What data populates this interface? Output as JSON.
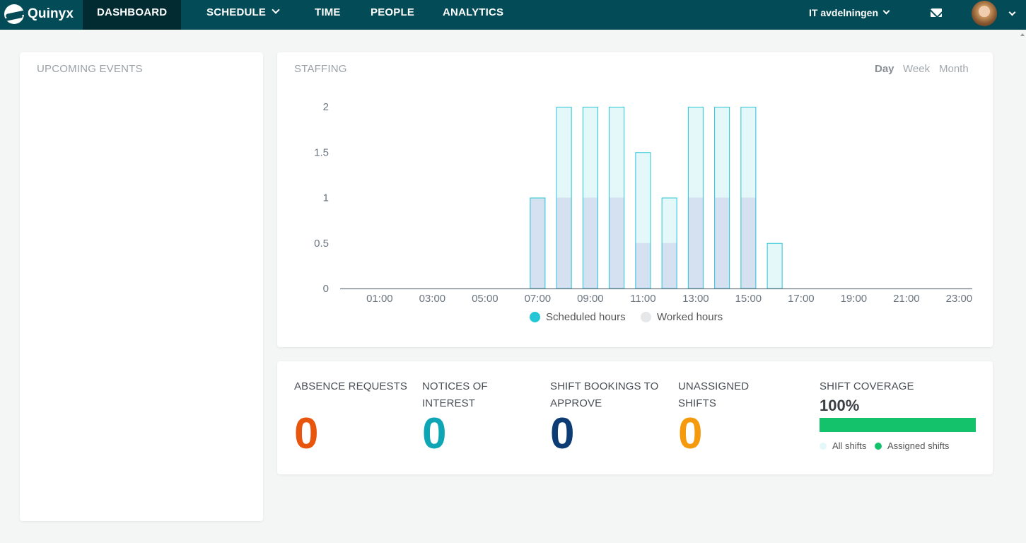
{
  "brand": {
    "name": "Quinyx"
  },
  "nav": {
    "dashboard": "DASHBOARD",
    "schedule": "SCHEDULE",
    "time": "TIME",
    "people": "PEOPLE",
    "analytics": "ANALYTICS"
  },
  "header": {
    "department": "IT avdelningen",
    "mail_icon": "mail-icon",
    "avatar_icon": "user-avatar"
  },
  "events": {
    "title": "UPCOMING EVENTS"
  },
  "staffing": {
    "title": "STAFFING",
    "periods": {
      "day": "Day",
      "week": "Week",
      "month": "Month"
    },
    "selected_period": "Day",
    "legend": {
      "scheduled": "Scheduled hours",
      "worked": "Worked hours"
    }
  },
  "chart_data": {
    "type": "bar",
    "x": [
      "00:00",
      "01:00",
      "02:00",
      "03:00",
      "04:00",
      "05:00",
      "06:00",
      "07:00",
      "08:00",
      "09:00",
      "10:00",
      "11:00",
      "12:00",
      "13:00",
      "14:00",
      "15:00",
      "16:00",
      "17:00",
      "18:00",
      "19:00",
      "20:00",
      "21:00",
      "22:00",
      "23:00"
    ],
    "tick_labels": [
      "01:00",
      "03:00",
      "05:00",
      "07:00",
      "09:00",
      "11:00",
      "13:00",
      "15:00",
      "17:00",
      "19:00",
      "21:00",
      "23:00"
    ],
    "y_ticks": [
      "0",
      "0.5",
      "1",
      "1.5",
      "2"
    ],
    "ylim": [
      0,
      2
    ],
    "series": [
      {
        "name": "Scheduled hours",
        "values": [
          0,
          0,
          0,
          0,
          0,
          0,
          0,
          1,
          2,
          2,
          2,
          1.5,
          1,
          2,
          2,
          2,
          0.5,
          0,
          0,
          0,
          0,
          0,
          0,
          0
        ]
      },
      {
        "name": "Worked hours",
        "values": [
          0,
          0,
          0,
          0,
          0,
          0,
          0,
          1,
          1,
          1,
          1,
          0.5,
          0.5,
          1,
          1,
          1,
          0,
          0,
          0,
          0,
          0,
          0,
          0,
          0
        ]
      }
    ],
    "colors": {
      "scheduled_fill": "#e4f8f9",
      "scheduled_stroke": "#27c6d6",
      "worked_fill": "#d5e0f0",
      "axis": "#6b7580"
    },
    "grid": false,
    "legend_position": "bottom"
  },
  "stats": {
    "absence": {
      "label": "ABSENCE REQUESTS",
      "value": "0",
      "color": "#e8550d"
    },
    "notices": {
      "label_1": "NOTICES OF",
      "label_2": "INTEREST",
      "value": "0",
      "color": "#0ea5b5"
    },
    "bookings": {
      "label_1": "SHIFT BOOKINGS TO",
      "label_2": "APPROVE",
      "value": "0",
      "color": "#0d3c75"
    },
    "unassigned": {
      "label_1": "UNASSIGNED",
      "label_2": "SHIFTS",
      "value": "0",
      "color": "#f59a0c"
    },
    "coverage": {
      "label": "SHIFT COVERAGE",
      "percent_text": "100%",
      "fraction": 1.0,
      "legend_all": "All shifts",
      "legend_assigned": "Assigned shifts",
      "color_all": "#e4f8f9",
      "color_assigned": "#13c26b"
    }
  }
}
